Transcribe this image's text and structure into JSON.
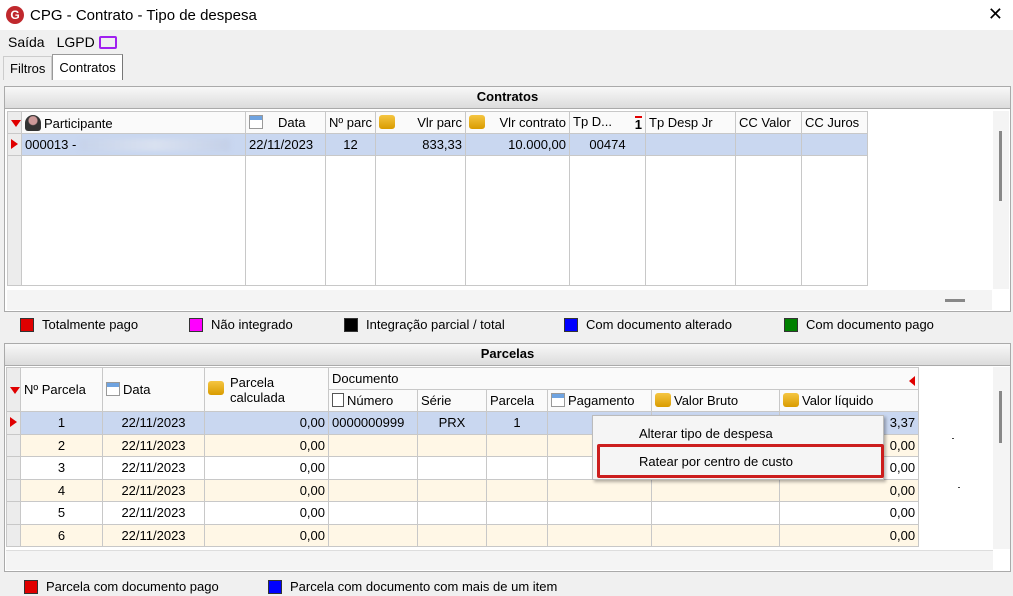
{
  "window": {
    "title": "CPG - Contrato - Tipo de despesa",
    "close_glyph": "✕",
    "app_icon_letter": "G"
  },
  "menu": {
    "saida": "Saída",
    "lgpd": "LGPD"
  },
  "tabs": [
    {
      "label": "Filtros"
    },
    {
      "label": "Contratos"
    }
  ],
  "contratos": {
    "title": "Contratos",
    "columns": {
      "participante": "Participante",
      "data": "Data",
      "nparc": "Nº parc",
      "vlr_parc": "Vlr parc",
      "vlr_contrato": "Vlr contrato",
      "tp_d": "Tp D...",
      "tp_sort": "1",
      "tp_desp_jr": "Tp Desp Jr",
      "cc_valor": "CC Valor",
      "cc_juros": "CC Juros"
    },
    "row": {
      "participante": "000013 -",
      "data": "22/11/2023",
      "nparc": "12",
      "vlr_parc": "833,33",
      "vlr_contrato": "10.000,00",
      "tp_d": "00474"
    }
  },
  "legend_top": [
    {
      "label": "Totalmente pago",
      "color": "#e00000"
    },
    {
      "label": "Não integrado",
      "color": "#ff00ff"
    },
    {
      "label": "Integração parcial / total",
      "color": "#000000"
    },
    {
      "label": "Com documento alterado",
      "color": "#0000ff"
    },
    {
      "label": "Com documento pago",
      "color": "#008000"
    }
  ],
  "parcelas": {
    "title": "Parcelas",
    "columns": {
      "nparcela": "Nº Parcela",
      "data": "Data",
      "parcela_calc_1": "Parcela",
      "parcela_calc_2": "calculada",
      "documento": "Documento",
      "numero": "Número",
      "serie": "Série",
      "parcela": "Parcela",
      "pagamento": "Pagamento",
      "valor_bruto": "Valor Bruto",
      "valor_liquido": "Valor líquido"
    },
    "rows": [
      {
        "n": "1",
        "data": "22/11/2023",
        "calc": "0,00",
        "numero": "0000000999",
        "serie": "PRX",
        "parcela": "1",
        "liquido": "3,37"
      },
      {
        "n": "2",
        "data": "22/11/2023",
        "calc": "0,00",
        "numero": "",
        "serie": "",
        "parcela": "",
        "liquido": "0,00"
      },
      {
        "n": "3",
        "data": "22/11/2023",
        "calc": "0,00",
        "numero": "",
        "serie": "",
        "parcela": "",
        "liquido": "0,00"
      },
      {
        "n": "4",
        "data": "22/11/2023",
        "calc": "0,00",
        "numero": "",
        "serie": "",
        "parcela": "",
        "liquido": "0,00"
      },
      {
        "n": "5",
        "data": "22/11/2023",
        "calc": "0,00",
        "numero": "",
        "serie": "",
        "parcela": "",
        "liquido": "0,00"
      },
      {
        "n": "6",
        "data": "22/11/2023",
        "calc": "0,00",
        "numero": "",
        "serie": "",
        "parcela": "",
        "liquido": "0,00"
      }
    ]
  },
  "context_menu": {
    "items": [
      {
        "label": "Alterar tipo de despesa"
      },
      {
        "label": "Ratear por centro de custo"
      }
    ]
  },
  "legend_bottom": [
    {
      "label": "Parcela com documento pago",
      "color": "#e00000"
    },
    {
      "label": "Parcela com documento com mais de um item",
      "color": "#0000ff"
    }
  ]
}
